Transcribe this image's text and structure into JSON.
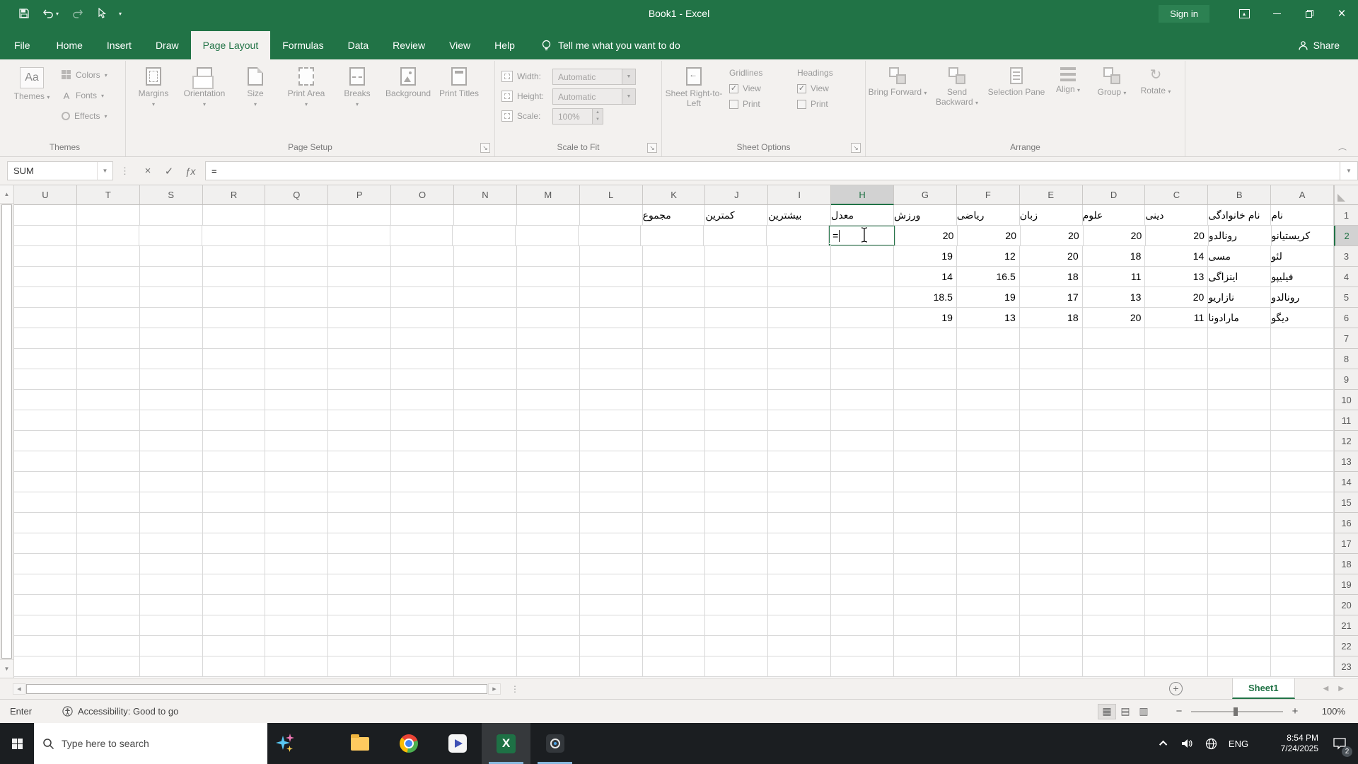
{
  "colors": {
    "excel_green": "#217346",
    "active_cell_border": "#217346",
    "taskbar_bg": "#1b1e21"
  },
  "titlebar": {
    "title": "Book1 - Excel",
    "sign_in": "Sign in"
  },
  "tabs": {
    "file": "File",
    "items": [
      "Home",
      "Insert",
      "Draw",
      "Page Layout",
      "Formulas",
      "Data",
      "Review",
      "View",
      "Help"
    ],
    "active": "Page Layout",
    "tell_me": "Tell me what you want to do",
    "share": "Share"
  },
  "ribbon": {
    "themes": {
      "label": "Themes",
      "button": "Themes",
      "colors": "Colors",
      "fonts": "Fonts",
      "effects": "Effects"
    },
    "page_setup": {
      "label": "Page Setup",
      "margins": "Margins",
      "orientation": "Orientation",
      "size": "Size",
      "print_area": "Print Area",
      "breaks": "Breaks",
      "background": "Background",
      "print_titles": "Print Titles"
    },
    "scale_to_fit": {
      "label": "Scale to Fit",
      "width": "Width:",
      "height": "Height:",
      "scale": "Scale:",
      "width_value": "Automatic",
      "height_value": "Automatic",
      "scale_value": "100%"
    },
    "sheet_options": {
      "label": "Sheet Options",
      "rtl_button": "Sheet Right-to-Left",
      "gridlines": "Gridlines",
      "headings": "Headings",
      "view": "View",
      "print": "Print"
    },
    "arrange": {
      "label": "Arrange",
      "bring_forward": "Bring Forward",
      "send_backward": "Send Backward",
      "selection_pane": "Selection Pane",
      "align": "Align",
      "group": "Group",
      "rotate": "Rotate"
    }
  },
  "formula_bar": {
    "name_box": "SUM",
    "formula": "="
  },
  "grid": {
    "columns_display_order": [
      "U",
      "T",
      "S",
      "R",
      "Q",
      "P",
      "O",
      "N",
      "M",
      "L",
      "K",
      "J",
      "I",
      "H",
      "G",
      "F",
      "E",
      "D",
      "C",
      "B",
      "A"
    ],
    "active_column": "H",
    "active_row": 2,
    "rows_visible": 23,
    "cells": {
      "A1": "نام",
      "B1": "نام خانوادگی",
      "C1": "دینی",
      "D1": "علوم",
      "E1": "زبان",
      "F1": "ریاضی",
      "G1": "ورزش",
      "H1": "معدل",
      "I1": "بیشترین",
      "J1": "کمترین",
      "K1": "مجموع",
      "A2": "کریستیانو",
      "B2": "رونالدو",
      "C2": "20",
      "D2": "20",
      "E2": "20",
      "F2": "20",
      "G2": "20",
      "H2": "=",
      "A3": "لئو",
      "B3": "مسی",
      "C3": "14",
      "D3": "18",
      "E3": "20",
      "F3": "12",
      "G3": "19",
      "A4": "فیلیپو",
      "B4": "اینزاگی",
      "C4": "13",
      "D4": "11",
      "E4": "18",
      "F4": "16.5",
      "G4": "14",
      "A5": "رونالدو",
      "B5": "نازاریو",
      "C5": "20",
      "D5": "13",
      "E5": "17",
      "F5": "19",
      "G5": "18.5",
      "A6": "دیگو",
      "B6": "مارادونا",
      "C6": "11",
      "D6": "20",
      "E6": "18",
      "F6": "13",
      "G6": "19"
    }
  },
  "sheet_bar": {
    "active_tab": "Sheet1",
    "add_sheet": "+"
  },
  "status_bar": {
    "mode": "Enter",
    "accessibility": "Accessibility: Good to go",
    "zoom_level": "100%"
  },
  "taskbar": {
    "search_placeholder": "Type here to search",
    "language": "ENG",
    "time": "8:54 PM",
    "date": "7/24/2025",
    "notification_count": "2"
  }
}
